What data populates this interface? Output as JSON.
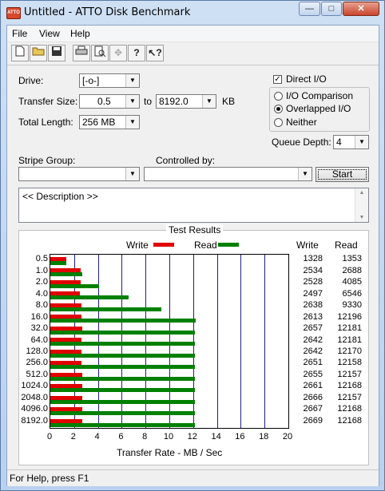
{
  "window": {
    "title": "Untitled - ATTO Disk Benchmark",
    "minimize": "—",
    "maximize": "□",
    "close": "✕",
    "app_icon": "ATTO"
  },
  "menu": [
    "File",
    "View",
    "Help"
  ],
  "toolbar": {
    "icons": [
      "new-file-icon",
      "open-folder-icon",
      "save-icon",
      "print-icon",
      "print-preview-icon",
      "move-icon",
      "help-icon",
      "context-help-icon"
    ]
  },
  "settings": {
    "drive_label": "Drive:",
    "drive_value": "[-o-]",
    "transfer_size_label": "Transfer Size:",
    "transfer_from": "0.5",
    "to_label": "to",
    "transfer_to": "8192.0",
    "kb_label": "KB",
    "total_length_label": "Total Length:",
    "total_length_value": "256 MB",
    "direct_io_label": "Direct I/O",
    "direct_io_checked": true,
    "io_comparison_label": "I/O Comparison",
    "overlapped_io_label": "Overlapped I/O",
    "neither_label": "Neither",
    "selected_mode": "Overlapped I/O",
    "queue_depth_label": "Queue Depth:",
    "queue_depth_value": "4",
    "stripe_group_label": "Stripe Group:",
    "stripe_group_value": "",
    "controlled_by_label": "Controlled by:",
    "controlled_by_value": "",
    "start_label": "Start",
    "description": "<< Description >>"
  },
  "results": {
    "title": "Test Results",
    "write_legend": "Write",
    "read_legend": "Read",
    "write_col": "Write",
    "read_col": "Read",
    "xlabel": "Transfer Rate - MB / Sec",
    "write_color": "#e00000",
    "read_color": "#008000"
  },
  "chart_data": {
    "type": "bar",
    "orientation": "horizontal",
    "categories": [
      "0.5",
      "1.0",
      "2.0",
      "4.0",
      "8.0",
      "16.0",
      "32.0",
      "64.0",
      "128.0",
      "256.0",
      "512.0",
      "1024.0",
      "2048.0",
      "4096.0",
      "8192.0"
    ],
    "series": [
      {
        "name": "Write",
        "values": [
          1328,
          2534,
          2528,
          2497,
          2638,
          2613,
          2657,
          2642,
          2642,
          2651,
          2655,
          2661,
          2666,
          2667,
          2669
        ]
      },
      {
        "name": "Read",
        "values": [
          1353,
          2688,
          4085,
          6546,
          9330,
          12196,
          12181,
          12181,
          12170,
          12158,
          12157,
          12168,
          12157,
          12168,
          12168
        ]
      }
    ],
    "xlabel": "Transfer Rate - MB / Sec",
    "xlim": [
      0,
      20
    ],
    "xticks": [
      "0",
      "2",
      "4",
      "6",
      "8",
      "10",
      "12",
      "14",
      "16",
      "18",
      "20"
    ],
    "value_scale_note": "bars plotted as KB/s ÷ 1000",
    "grid": true
  },
  "status": "For Help, press F1"
}
